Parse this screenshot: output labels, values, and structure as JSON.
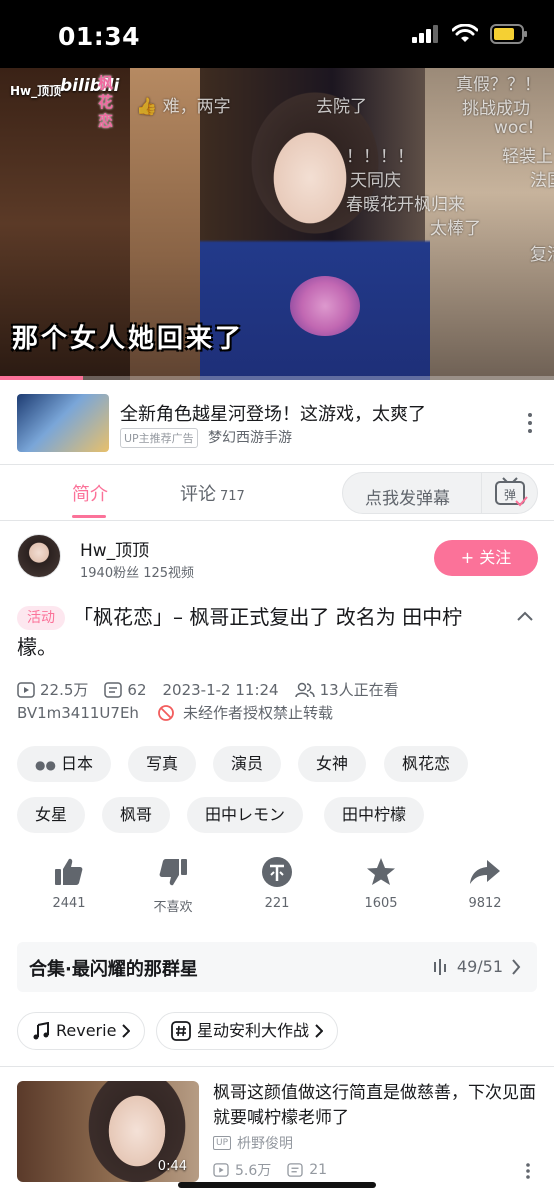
{
  "status_bar": {
    "time": "01:34"
  },
  "video": {
    "uploader_overlay": "Hw_顶顶",
    "logo": "bilibili",
    "vertical_title": "枫花恋",
    "caption": "那个女人她回来了",
    "progress": 0.15,
    "danmaku": [
      "难，两字",
      "去院了",
      "真假？？！",
      "挑战成功",
      "woc!",
      "轻装上",
      "！！！！",
      "法国",
      "天同庆",
      "春暖花开枫归来",
      "太棒了",
      "复活"
    ]
  },
  "ad": {
    "title": "全新角色越星河登场！这游戏，太爽了",
    "tag": "UP主推荐广告",
    "source": "梦幻西游手游"
  },
  "tabs": {
    "intro": "简介",
    "comments": "评论",
    "comment_count": "717",
    "danmaku_placeholder": "点我发弹幕",
    "danmaku_button": "弹"
  },
  "uploader": {
    "name": "Hw_顶顶",
    "stats": "1940粉丝  125视频",
    "follow": "+ 关注"
  },
  "video_info": {
    "activity_tag": "活动",
    "title": "「枫花恋」– 枫哥正式复出了  改名为 田中柠檬。",
    "views": "22.5万",
    "danmaku_count": "62",
    "date": "2023-1-2 11:24",
    "watching": "13人正在看",
    "bvid": "BV1m3411U7Eh",
    "copyright": "未经作者授权禁止转载"
  },
  "tags": [
    "日本",
    "写真",
    "演员",
    "女神",
    "枫花恋",
    "女星",
    "枫哥",
    "田中レモン",
    "田中柠檬"
  ],
  "actions": {
    "like": "2441",
    "dislike": "不喜欢",
    "coin": "221",
    "favorite": "1605",
    "share": "9812"
  },
  "collection": {
    "title": "合集·最闪耀的那群星",
    "progress": "49/51"
  },
  "pills": {
    "music": "Reverie",
    "activity": "星动安利大作战"
  },
  "related": {
    "title": "枫哥这颜值做这行简直是做慈善，下次见面就要喊柠檬老师了",
    "up_badge": "UP",
    "up_name": "枡野俊明",
    "duration": "0:44",
    "views": "5.6万",
    "danmaku": "21"
  },
  "colors": {
    "accent": "#fb7299",
    "text": "#18191c",
    "secondary": "#61666d"
  }
}
